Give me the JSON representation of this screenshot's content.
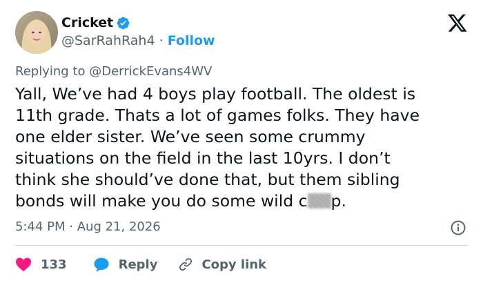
{
  "author": {
    "display_name": "Cricket",
    "handle": "@SarRahRah4",
    "separator": "·",
    "follow_label": "Follow"
  },
  "reply_context": {
    "prefix": "Replying to",
    "target": "@DerrickEvans4WV"
  },
  "tweet": {
    "lines": [
      "Yall, We’ve had 4 boys play football. The oldest is",
      "11th grade. Thats a lot of games folks. They have",
      "one elder sister. We’ve seen some crummy",
      "situations on the field in the last 10yrs. I don’t",
      "think she should’ve done that, but them sibling",
      "bonds will make you do some wild c"
    ],
    "last_line_end": "p."
  },
  "meta": {
    "time": "5:44 PM",
    "separator": "·",
    "date": "Aug 21, 2026"
  },
  "actions": {
    "like_count": "133",
    "reply_label": "Reply",
    "copy_label": "Copy link"
  },
  "colors": {
    "accent": "#1d9bf0",
    "like": "#f91880",
    "muted": "#536471",
    "text": "#0f1419",
    "divider": "#cfd9de"
  },
  "icons": [
    "verified-badge-icon",
    "x-logo-icon",
    "info-icon",
    "heart-icon",
    "reply-bubble-icon",
    "link-icon"
  ]
}
